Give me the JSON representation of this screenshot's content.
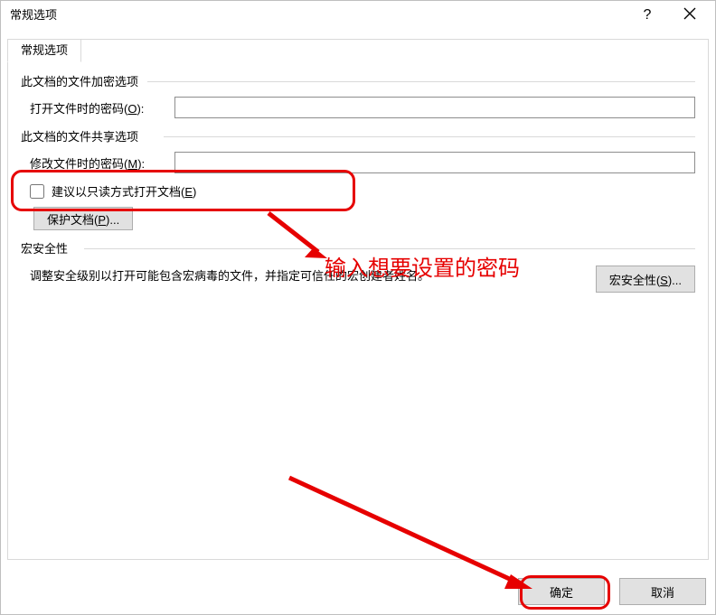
{
  "window": {
    "title": "常规选项"
  },
  "tabs": {
    "selected": "常规选项"
  },
  "encrypt": {
    "legend": "此文档的文件加密选项",
    "open_pwd_label": "打开文件时的密码(O):",
    "open_pwd_value": ""
  },
  "share": {
    "legend": "此文档的文件共享选项",
    "mod_pwd_label": "修改文件时的密码(M):",
    "mod_pwd_value": "",
    "readonly_label": "建议以只读方式打开文档(E)",
    "readonly_checked": false,
    "protect_btn": "保护文档(P)..."
  },
  "macro": {
    "legend": "宏安全性",
    "desc": "调整安全级别以打开可能包含宏病毒的文件，并指定可信任的宏创建者姓名。",
    "btn": "宏安全性(S)..."
  },
  "buttons": {
    "ok": "确定",
    "cancel": "取消"
  },
  "annotation": {
    "text1": "输入想要设置的密码"
  }
}
